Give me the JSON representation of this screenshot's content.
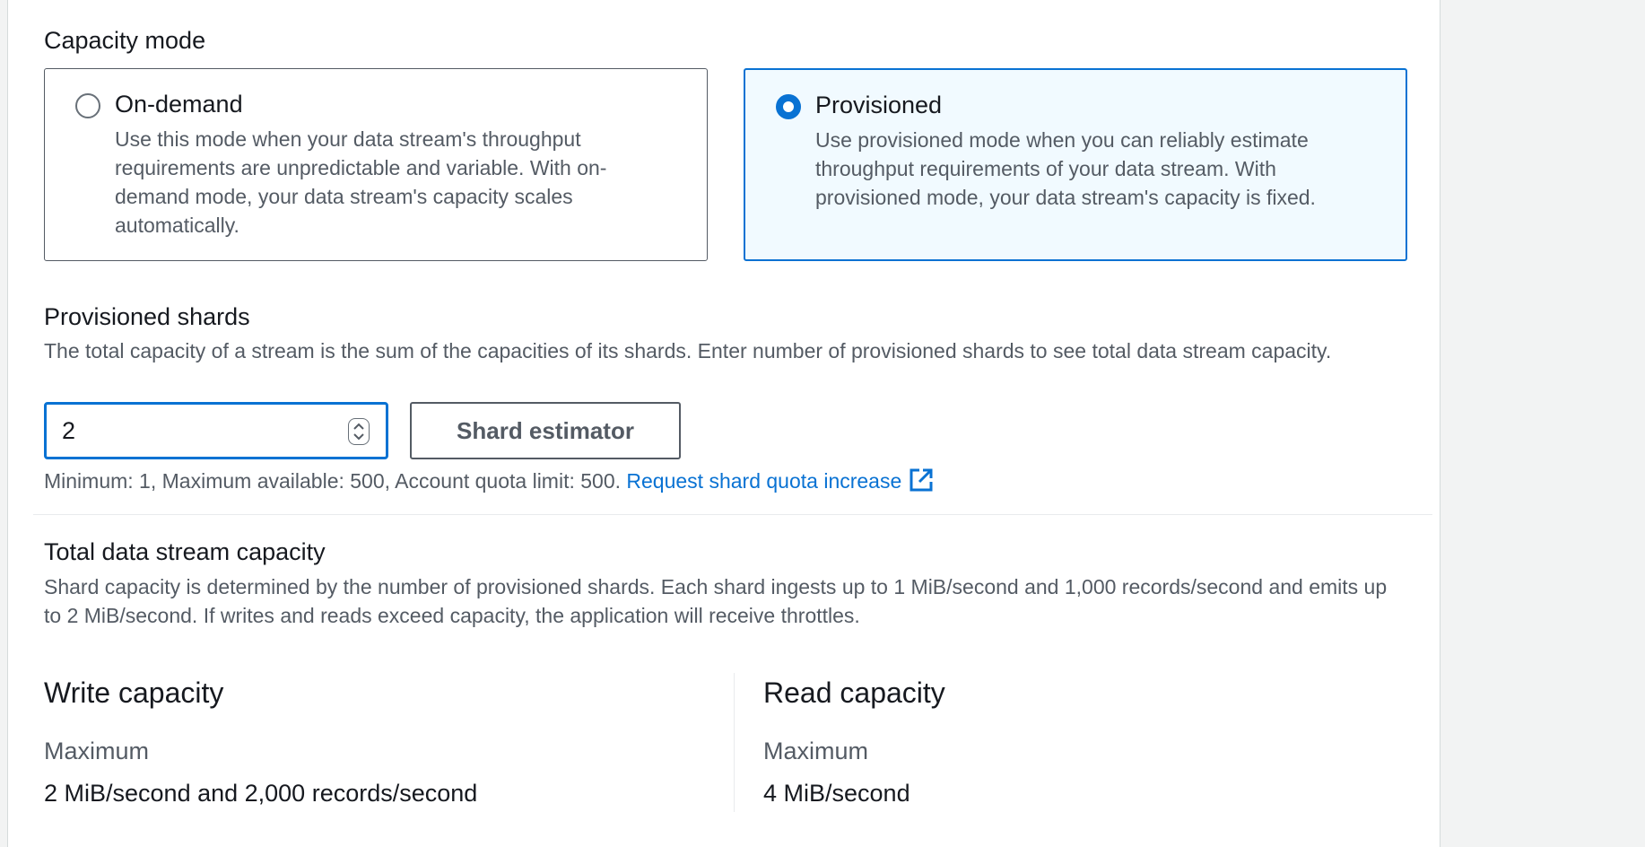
{
  "capacity_mode": {
    "label": "Capacity mode",
    "options": [
      {
        "title": "On-demand",
        "description": "Use this mode when your data stream's throughput requirements are unpredictable and variable. With on-demand mode, your data stream's capacity scales automatically.",
        "selected": false
      },
      {
        "title": "Provisioned",
        "description": "Use provisioned mode when you can reliably estimate throughput requirements of your data stream. With provisioned mode, your data stream's capacity is fixed.",
        "selected": true
      }
    ]
  },
  "provisioned_shards": {
    "label": "Provisioned shards",
    "description": "The total capacity of a stream is the sum of the capacities of its shards. Enter number of provisioned shards to see total data stream capacity.",
    "value": "2",
    "estimator_button": "Shard estimator",
    "constraint_text": "Minimum: 1, Maximum available: 500, Account quota limit: 500.",
    "quota_link": "Request shard quota increase"
  },
  "total_capacity": {
    "label": "Total data stream capacity",
    "description": "Shard capacity is determined by the number of provisioned shards. Each shard ingests up to 1 MiB/second and 1,000 records/second and emits up to 2 MiB/second. If writes and reads exceed capacity, the application will receive throttles.",
    "write": {
      "heading": "Write capacity",
      "key": "Maximum",
      "value": "2 MiB/second and 2,000 records/second"
    },
    "read": {
      "heading": "Read capacity",
      "key": "Maximum",
      "value": "4 MiB/second"
    }
  },
  "colors": {
    "accent": "#0972d3",
    "selected_bg": "#f1faff",
    "text_secondary": "#545b64"
  }
}
